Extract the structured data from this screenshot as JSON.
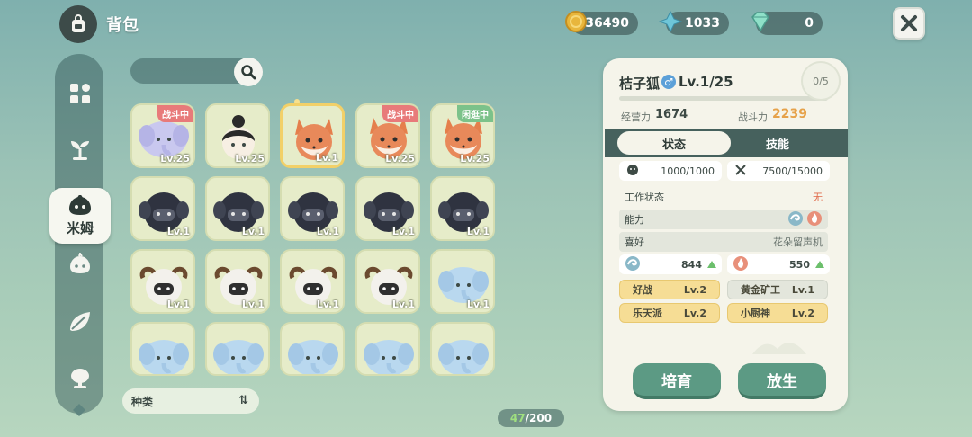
{
  "header": {
    "title": "背包"
  },
  "currencies": [
    {
      "icon": "gold-coin-icon",
      "value": "36490"
    },
    {
      "icon": "blue-crystal-icon",
      "value": "1033"
    },
    {
      "icon": "gem-icon",
      "value": "0"
    }
  ],
  "sidebar": {
    "items": [
      {
        "icon": "grid-icon"
      },
      {
        "icon": "sprout-icon"
      },
      {
        "icon": "slime-icon",
        "label": "米姆",
        "active": true
      },
      {
        "icon": "slime-outline-icon"
      },
      {
        "icon": "leaf-icon"
      },
      {
        "icon": "tree-icon"
      }
    ]
  },
  "search": {
    "placeholder": ""
  },
  "grid": {
    "cells": [
      {
        "pet": "elephant-purple",
        "level": "Lv.25",
        "tag": "战斗中",
        "tag_type": "fight"
      },
      {
        "pet": "black-hair",
        "level": "Lv.25"
      },
      {
        "pet": "fox",
        "level": "Lv.1",
        "selected": true
      },
      {
        "pet": "fox",
        "level": "Lv.25",
        "tag": "战斗中",
        "tag_type": "fight"
      },
      {
        "pet": "fox",
        "level": "Lv.25",
        "tag": "闲逛中",
        "tag_type": "idle"
      },
      {
        "pet": "black-sheep",
        "level": "Lv.1"
      },
      {
        "pet": "black-sheep",
        "level": "Lv.1"
      },
      {
        "pet": "black-sheep",
        "level": "Lv.1"
      },
      {
        "pet": "black-sheep",
        "level": "Lv.1"
      },
      {
        "pet": "black-sheep",
        "level": "Lv.1"
      },
      {
        "pet": "white-sheep",
        "level": "Lv.1"
      },
      {
        "pet": "white-sheep",
        "level": "Lv.1"
      },
      {
        "pet": "white-sheep",
        "level": "Lv.1"
      },
      {
        "pet": "white-sheep",
        "level": "Lv.1"
      },
      {
        "pet": "elephant-blue",
        "level": "Lv.1"
      },
      {
        "pet": "elephant-blue",
        "level": ""
      },
      {
        "pet": "elephant-blue",
        "level": ""
      },
      {
        "pet": "elephant-blue",
        "level": ""
      },
      {
        "pet": "elephant-blue",
        "level": ""
      },
      {
        "pet": "elephant-blue",
        "level": ""
      }
    ]
  },
  "sort": {
    "label": "种类"
  },
  "capacity": {
    "current": "47",
    "total": "/200"
  },
  "detail": {
    "name": "桔子狐",
    "gender": "♂",
    "level": "Lv.1/25",
    "badge": "0/5",
    "level_progress": 0,
    "labels": {
      "operation": "经营力",
      "combat": "战斗力"
    },
    "operation": "1674",
    "combat": "2239",
    "tabs": {
      "status": "状态",
      "skill": "技能"
    },
    "hunger": "1000/1000",
    "stamina": "7500/15000",
    "work_status_label": "工作状态",
    "work_status_value": "无",
    "ability_label": "能力",
    "hobby_label": "喜好",
    "hobby_value": "花朵留声机",
    "ability_values": {
      "wind": "844",
      "fire": "550"
    },
    "traits": [
      {
        "name": "好战",
        "level": "Lv.2",
        "style": "gold"
      },
      {
        "name": "黄金矿工",
        "level": "Lv.1",
        "style": "gray"
      },
      {
        "name": "乐天派",
        "level": "Lv.2",
        "style": "gold"
      },
      {
        "name": "小厨神",
        "level": "Lv.2",
        "style": "gold"
      }
    ],
    "buttons": {
      "nurture": "培育",
      "release": "放生"
    }
  }
}
